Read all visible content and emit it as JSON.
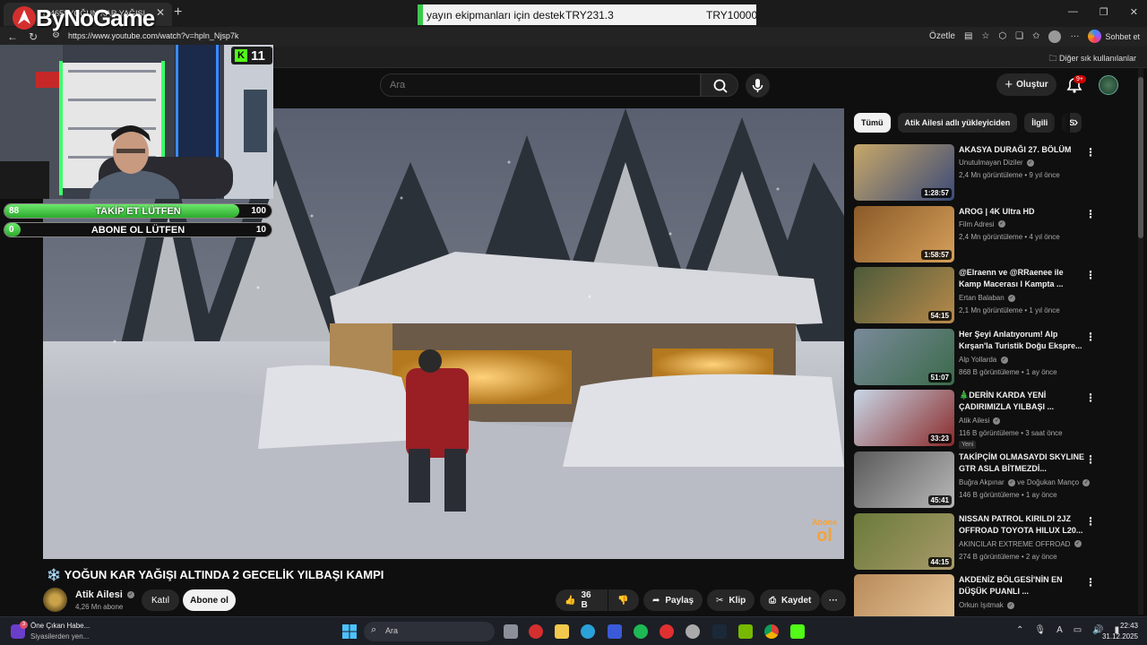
{
  "browser": {
    "tab_title": "(1465) YOĞUN KAR YAĞIŞI...",
    "url": "https://www.youtube.com/watch?v=hpln_Njsp7k",
    "summarize_label": "Özetle",
    "copilot_label": "Sohbet et",
    "other_bookmarks": "Diğer sık kullanılanlar"
  },
  "brand_overlay": {
    "text": "ByNoGame"
  },
  "ticker": {
    "message": "yayın ekipmanları için destek",
    "amount": "TRY231.3",
    "goal": "TRY10000"
  },
  "stream": {
    "kick_viewers": "11",
    "goals": [
      {
        "current": "88",
        "label": "TAKİP ET LÜTFEN",
        "target": "100",
        "progress": 0.88
      },
      {
        "current": "0",
        "label": "ABONE OL LÜTFEN",
        "target": "10",
        "progress": 0.0
      }
    ]
  },
  "yt": {
    "search_placeholder": "Ara",
    "create_label": "Oluştur",
    "notif_count": "9+"
  },
  "video": {
    "title": "❄️ YOĞUN KAR YAĞIŞI ALTINDA 2 GECELİK YILBAŞI KAMPI",
    "watermark_small": "Abone",
    "watermark_big": "ol",
    "channel": "Atik Ailesi",
    "subs": "4,26 Mn abone",
    "join_label": "Katıl",
    "subscribe_label": "Abone ol",
    "likes": "36 B",
    "share_label": "Paylaş",
    "clip_label": "Klip",
    "save_label": "Kaydet"
  },
  "chips": [
    "Tümü",
    "Atik Ailesi adlı yükleyiciden",
    "İlgili",
    "S"
  ],
  "recommendations": [
    {
      "title": "AKASYA DURAĞI 27. BÖLÜM",
      "channel": "Unutulmayan Diziler",
      "meta": "2,4 Mn görüntüleme • 9 yıl önce",
      "duration": "1:28:57",
      "badge": "",
      "c1": "#c8a868",
      "c2": "#3a4a78"
    },
    {
      "title": "AROG | 4K Ultra HD",
      "channel": "Film Adresi",
      "meta": "2,4 Mn görüntüleme • 4 yıl önce",
      "duration": "1:58:57",
      "badge": "",
      "c1": "#8a5a28",
      "c2": "#d6a05a"
    },
    {
      "title": "@Elraenn ve @RRaenee ile Kamp Macerası I Kampta ...",
      "channel": "Ertan Balaban",
      "meta": "2,1 Mn görüntüleme • 1 yıl önce",
      "duration": "54:15",
      "badge": "",
      "c1": "#4c5a3a",
      "c2": "#b88a4a"
    },
    {
      "title": "Her Şeyi Anlatıyorum! Alp Kırşan'la Turistik Doğu Ekspre...",
      "channel": "Alp Yollarda",
      "meta": "868 B görüntüleme • 1 ay önce",
      "duration": "51:07",
      "badge": "",
      "c1": "#7a8a9a",
      "c2": "#3a6a4a"
    },
    {
      "title": "🎄DERİN KARDA YENİ ÇADIRIMIZLA YILBAŞI ...",
      "channel": "Atik Ailesi",
      "meta": "116 B görüntüleme • 3 saat önce",
      "duration": "33:23",
      "badge": "Yeni",
      "c1": "#c8d8e8",
      "c2": "#8a2a2a"
    },
    {
      "title": "TAKİPÇİM OLMASAYDI SKYLINE GTR ASLA BİTMEZDİ...",
      "channel": "Buğra Akpınar",
      "channel2": "ve Doğukan Manço",
      "meta": "146 B görüntüleme • 1 ay önce",
      "duration": "45:41",
      "badge": "",
      "c1": "#5a5a5a",
      "c2": "#b8b8b8"
    },
    {
      "title": "NISSAN PATROL KIRILDI 2JZ OFFROAD TOYOTA HILUX L20...",
      "channel": "AKINCILAR EXTREME OFFROAD",
      "meta": "274 B görüntüleme • 2 ay önce",
      "duration": "44:15",
      "badge": "",
      "c1": "#6a7a3a",
      "c2": "#a89a6a"
    },
    {
      "title": "AKDENİZ BÖLGESİ'NİN EN DÜŞÜK PUANLI ...",
      "channel": "Orkun Işıtmak",
      "meta": "",
      "duration": "",
      "badge": "",
      "c1": "#b88a5a",
      "c2": "#e8c89a"
    }
  ],
  "taskbar": {
    "news_count": "3",
    "news_title": "Öne Çıkan Habe...",
    "news_sub": "Siyasilerden yen...",
    "search_placeholder": "Ara",
    "time": "22:43",
    "date": "31.12.2025"
  }
}
